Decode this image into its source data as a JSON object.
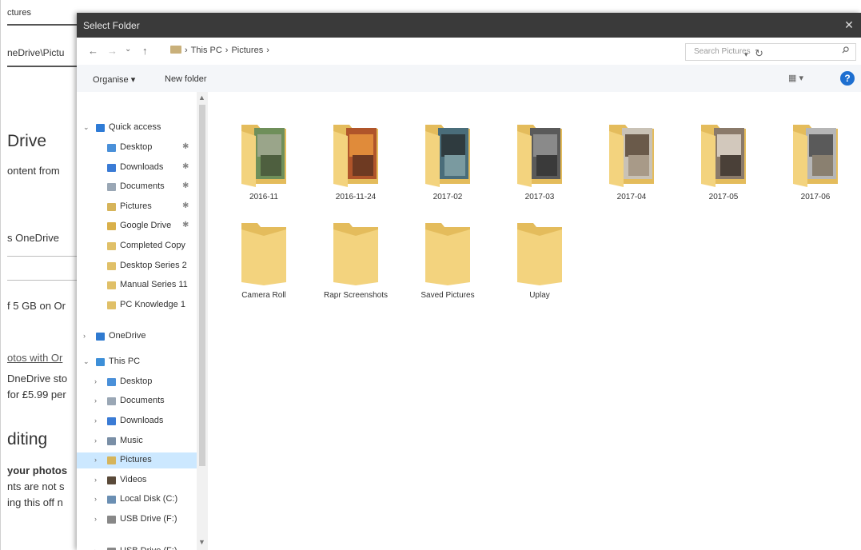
{
  "background_page": {
    "lines": [
      "ctures",
      "neDrive\\Pictu",
      "Drive",
      "ontent from",
      "s OneDrive",
      "f 5 GB on Or",
      "otos with Or",
      "DneDrive sto",
      "for £5.99 per",
      "diting",
      "your photos",
      "nts are not s",
      "ing this off n"
    ]
  },
  "dialog": {
    "title": "Select Folder",
    "close_glyph": "✕",
    "nav": {
      "back": "←",
      "forward": "→",
      "recent": "⌄",
      "up": "↑"
    },
    "address": {
      "crumbs": [
        "›",
        "This PC",
        "›",
        "Pictures",
        "›"
      ]
    },
    "search_placeholder": "Search Pictures",
    "toolbar": {
      "organize": "Organise ▾",
      "new_folder": "New folder",
      "view": "▦ ▾",
      "help": "?"
    },
    "nav_items": [
      {
        "label": "Quick access",
        "chev": "⌄",
        "pin": "",
        "color": "#2e7bd6"
      },
      {
        "label": "Desktop",
        "chev": "",
        "pin": "✱",
        "color": "#4a90d9"
      },
      {
        "label": "Downloads",
        "chev": "",
        "pin": "✱",
        "color": "#3a7bd5"
      },
      {
        "label": "Documents",
        "chev": "",
        "pin": "✱",
        "color": "#9aa7b5"
      },
      {
        "label": "Pictures",
        "chev": "",
        "pin": "✱",
        "color": "#d6b45a"
      },
      {
        "label": "Google Drive",
        "chev": "",
        "pin": "✱",
        "color": "#d9b04a"
      },
      {
        "label": "Completed Copy",
        "chev": "",
        "pin": "",
        "color": "#e0c068"
      },
      {
        "label": "Desktop Series 2",
        "chev": "",
        "pin": "",
        "color": "#e0c068"
      },
      {
        "label": "Manual Series 11",
        "chev": "",
        "pin": "",
        "color": "#e0c068"
      },
      {
        "label": "PC Knowledge 1",
        "chev": "",
        "pin": "",
        "color": "#e0c068"
      },
      {
        "label": "OneDrive",
        "chev": "›",
        "pin": "",
        "color": "#2f7ad0"
      },
      {
        "label": "This PC",
        "chev": "⌄",
        "pin": "",
        "color": "#3d8fd8"
      },
      {
        "label": "Desktop",
        "chev": "›",
        "pin": "",
        "color": "#4a90d9"
      },
      {
        "label": "Documents",
        "chev": "›",
        "pin": "",
        "color": "#9aa7b5"
      },
      {
        "label": "Downloads",
        "chev": "›",
        "pin": "",
        "color": "#3a7bd5"
      },
      {
        "label": "Music",
        "chev": "›",
        "pin": "",
        "color": "#7a8fa6"
      },
      {
        "label": "Pictures",
        "chev": "›",
        "pin": "",
        "color": "#d6b45a",
        "selected": true
      },
      {
        "label": "Videos",
        "chev": "›",
        "pin": "",
        "color": "#5a4a3a"
      },
      {
        "label": "Local Disk (C:)",
        "chev": "›",
        "pin": "",
        "color": "#6b8fb3"
      },
      {
        "label": "USB Drive (F:)",
        "chev": "›",
        "pin": "",
        "color": "#888888"
      },
      {
        "label": "USB Drive (F:)",
        "chev": "›",
        "pin": "",
        "color": "#888888"
      }
    ],
    "folders": [
      {
        "name": "2016-11",
        "photo": [
          "#6f8f5a",
          "#9aa58a",
          "#4e5f3f"
        ]
      },
      {
        "name": "2016-11-24",
        "photo": [
          "#b0552a",
          "#e08b3a",
          "#6e3a22"
        ]
      },
      {
        "name": "2017-02",
        "photo": [
          "#4a6d7a",
          "#2f3b3f",
          "#7a9aa0"
        ]
      },
      {
        "name": "2017-03",
        "photo": [
          "#5a5a5a",
          "#8a8a8a",
          "#3a3a3a"
        ]
      },
      {
        "name": "2017-04",
        "photo": [
          "#c9c2b6",
          "#6a5a4a",
          "#a89a88"
        ]
      },
      {
        "name": "2017-05",
        "photo": [
          "#8a7a6a",
          "#d2c8bc",
          "#4a4038"
        ]
      },
      {
        "name": "2017-06",
        "photo": [
          "#b6b6b6",
          "#5a5a5a",
          "#8a8070"
        ]
      },
      {
        "name": "Camera Roll",
        "photo": []
      },
      {
        "name": "Rapr Screenshots",
        "photo": []
      },
      {
        "name": "Saved Pictures",
        "photo": []
      },
      {
        "name": "Uplay",
        "photo": []
      }
    ],
    "colors": {
      "titlebar": "#3a3a3a",
      "folder_front": "#f3d37e",
      "folder_back": "#e4bc5c",
      "selection": "#cce8ff"
    }
  }
}
